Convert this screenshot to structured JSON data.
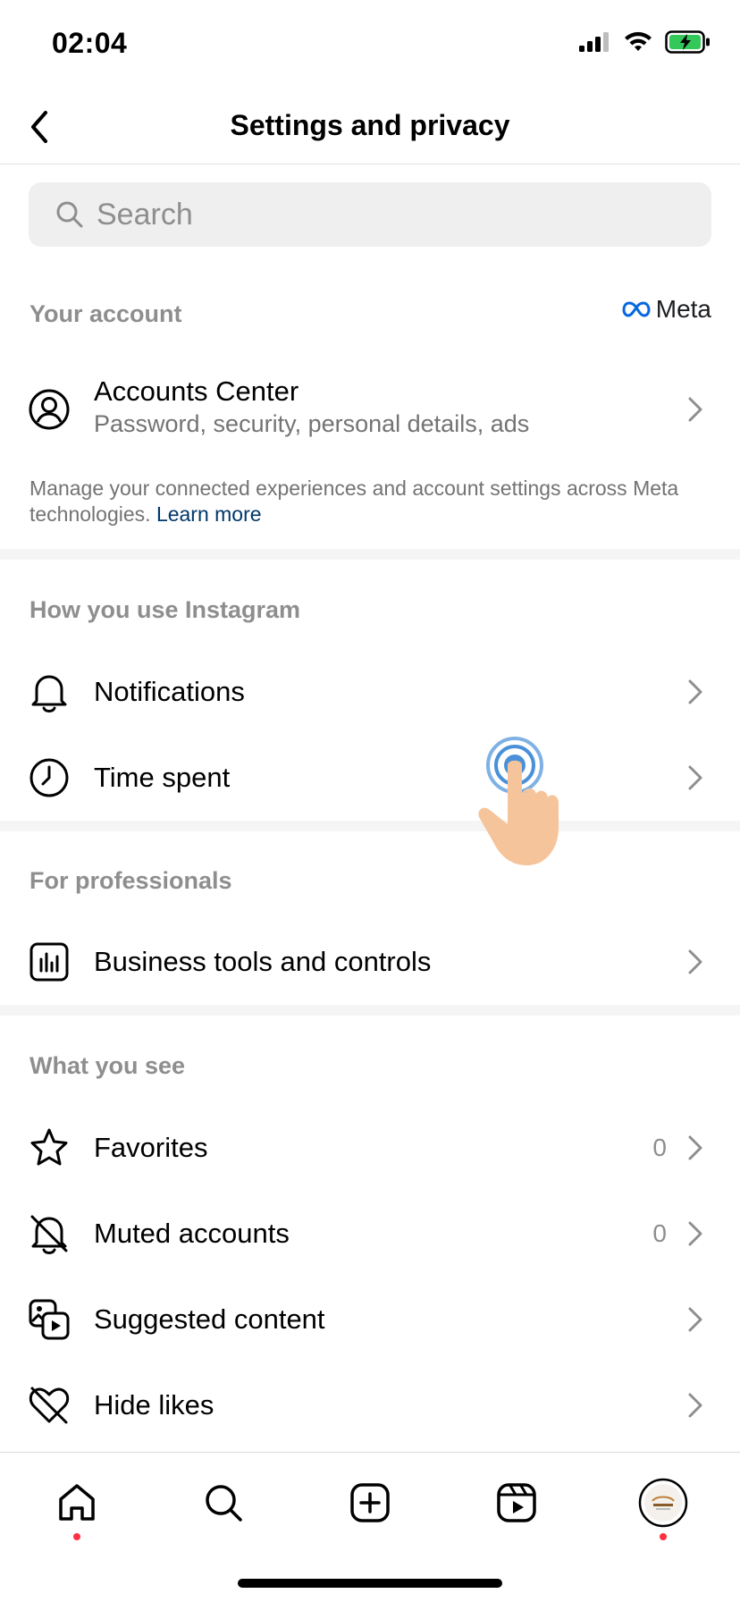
{
  "status_bar": {
    "time": "02:04"
  },
  "header": {
    "title": "Settings and privacy"
  },
  "search": {
    "placeholder": "Search"
  },
  "sections": {
    "your_account": {
      "title": "Your account",
      "brand": "Meta",
      "accounts_center": {
        "title": "Accounts Center",
        "subtitle": "Password, security, personal details, ads"
      },
      "description": "Manage your connected experiences and account settings across Meta technologies.",
      "learn_more": "Learn more"
    },
    "how_you_use": {
      "title": "How you use Instagram",
      "items": [
        {
          "label": "Notifications",
          "icon": "bell-icon"
        },
        {
          "label": "Time spent",
          "icon": "clock-icon"
        }
      ]
    },
    "for_professionals": {
      "title": "For professionals",
      "items": [
        {
          "label": "Business tools and controls",
          "icon": "chart-icon"
        }
      ]
    },
    "what_you_see": {
      "title": "What you see",
      "items": [
        {
          "label": "Favorites",
          "icon": "star-icon",
          "count": "0"
        },
        {
          "label": "Muted accounts",
          "icon": "muted-bell-icon",
          "count": "0"
        },
        {
          "label": "Suggested content",
          "icon": "suggested-content-icon"
        },
        {
          "label": "Hide likes",
          "icon": "hidden-heart-icon"
        }
      ]
    }
  },
  "tab_bar": {
    "tabs": [
      "home-icon",
      "search-icon",
      "create-icon",
      "reels-icon",
      "profile-avatar"
    ]
  },
  "colors": {
    "secondary_text": "#8e8e8e",
    "link": "#00376b",
    "notification_dot": "#ff3040",
    "meta_blue": "#0668e1",
    "battery_green": "#34c759",
    "touch_ring": "#4a90d9",
    "touch_hand": "#f6c49a"
  }
}
